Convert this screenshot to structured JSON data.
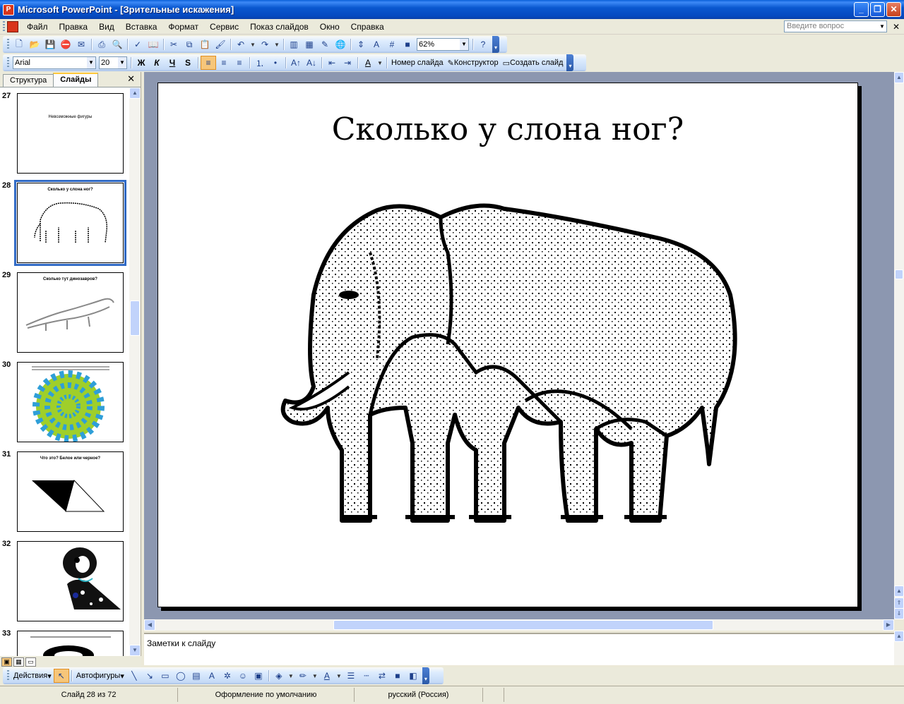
{
  "window": {
    "title": "Microsoft PowerPoint - [Зрительные искажения]"
  },
  "menu": {
    "items": [
      "Файл",
      "Правка",
      "Вид",
      "Вставка",
      "Формат",
      "Сервис",
      "Показ слайдов",
      "Окно",
      "Справка"
    ],
    "help_placeholder": "Введите вопрос"
  },
  "standard_toolbar": {
    "zoom": "62%"
  },
  "formatting_toolbar": {
    "font": "Arial",
    "font_size": "20",
    "bold": "Ж",
    "italic": "К",
    "underline": "Ч",
    "shadow": "S",
    "slide_number_label": "Номер слайда",
    "designer_label": "Конструктор",
    "new_slide_label": "Создать слайд"
  },
  "left_panel": {
    "tabs": [
      "Структура",
      "Слайды"
    ],
    "active_tab": "Слайды",
    "thumbnails": [
      {
        "number": "27",
        "title": "Невозможные фигуры"
      },
      {
        "number": "28",
        "title": "Сколько у слона ног?"
      },
      {
        "number": "29",
        "title": "Сколько тут динозавров?"
      },
      {
        "number": "30",
        "title": ""
      },
      {
        "number": "31",
        "title": "Что это? Белое или черное?"
      },
      {
        "number": "32",
        "title": ""
      },
      {
        "number": "33",
        "title": ""
      }
    ]
  },
  "slide": {
    "title": "Сколько у слона ног?"
  },
  "notes": {
    "placeholder": "Заметки к слайду"
  },
  "drawing_toolbar": {
    "actions_label": "Действия",
    "autoshapes_label": "Автофигуры"
  },
  "status": {
    "slide_position": "Слайд 28 из 72",
    "design": "Оформление по умолчанию",
    "language": "русский (Россия)"
  },
  "colors": {
    "titlebar": "#0a58d0",
    "selection": "#316ac5",
    "slide_background": "#8c97b0"
  }
}
